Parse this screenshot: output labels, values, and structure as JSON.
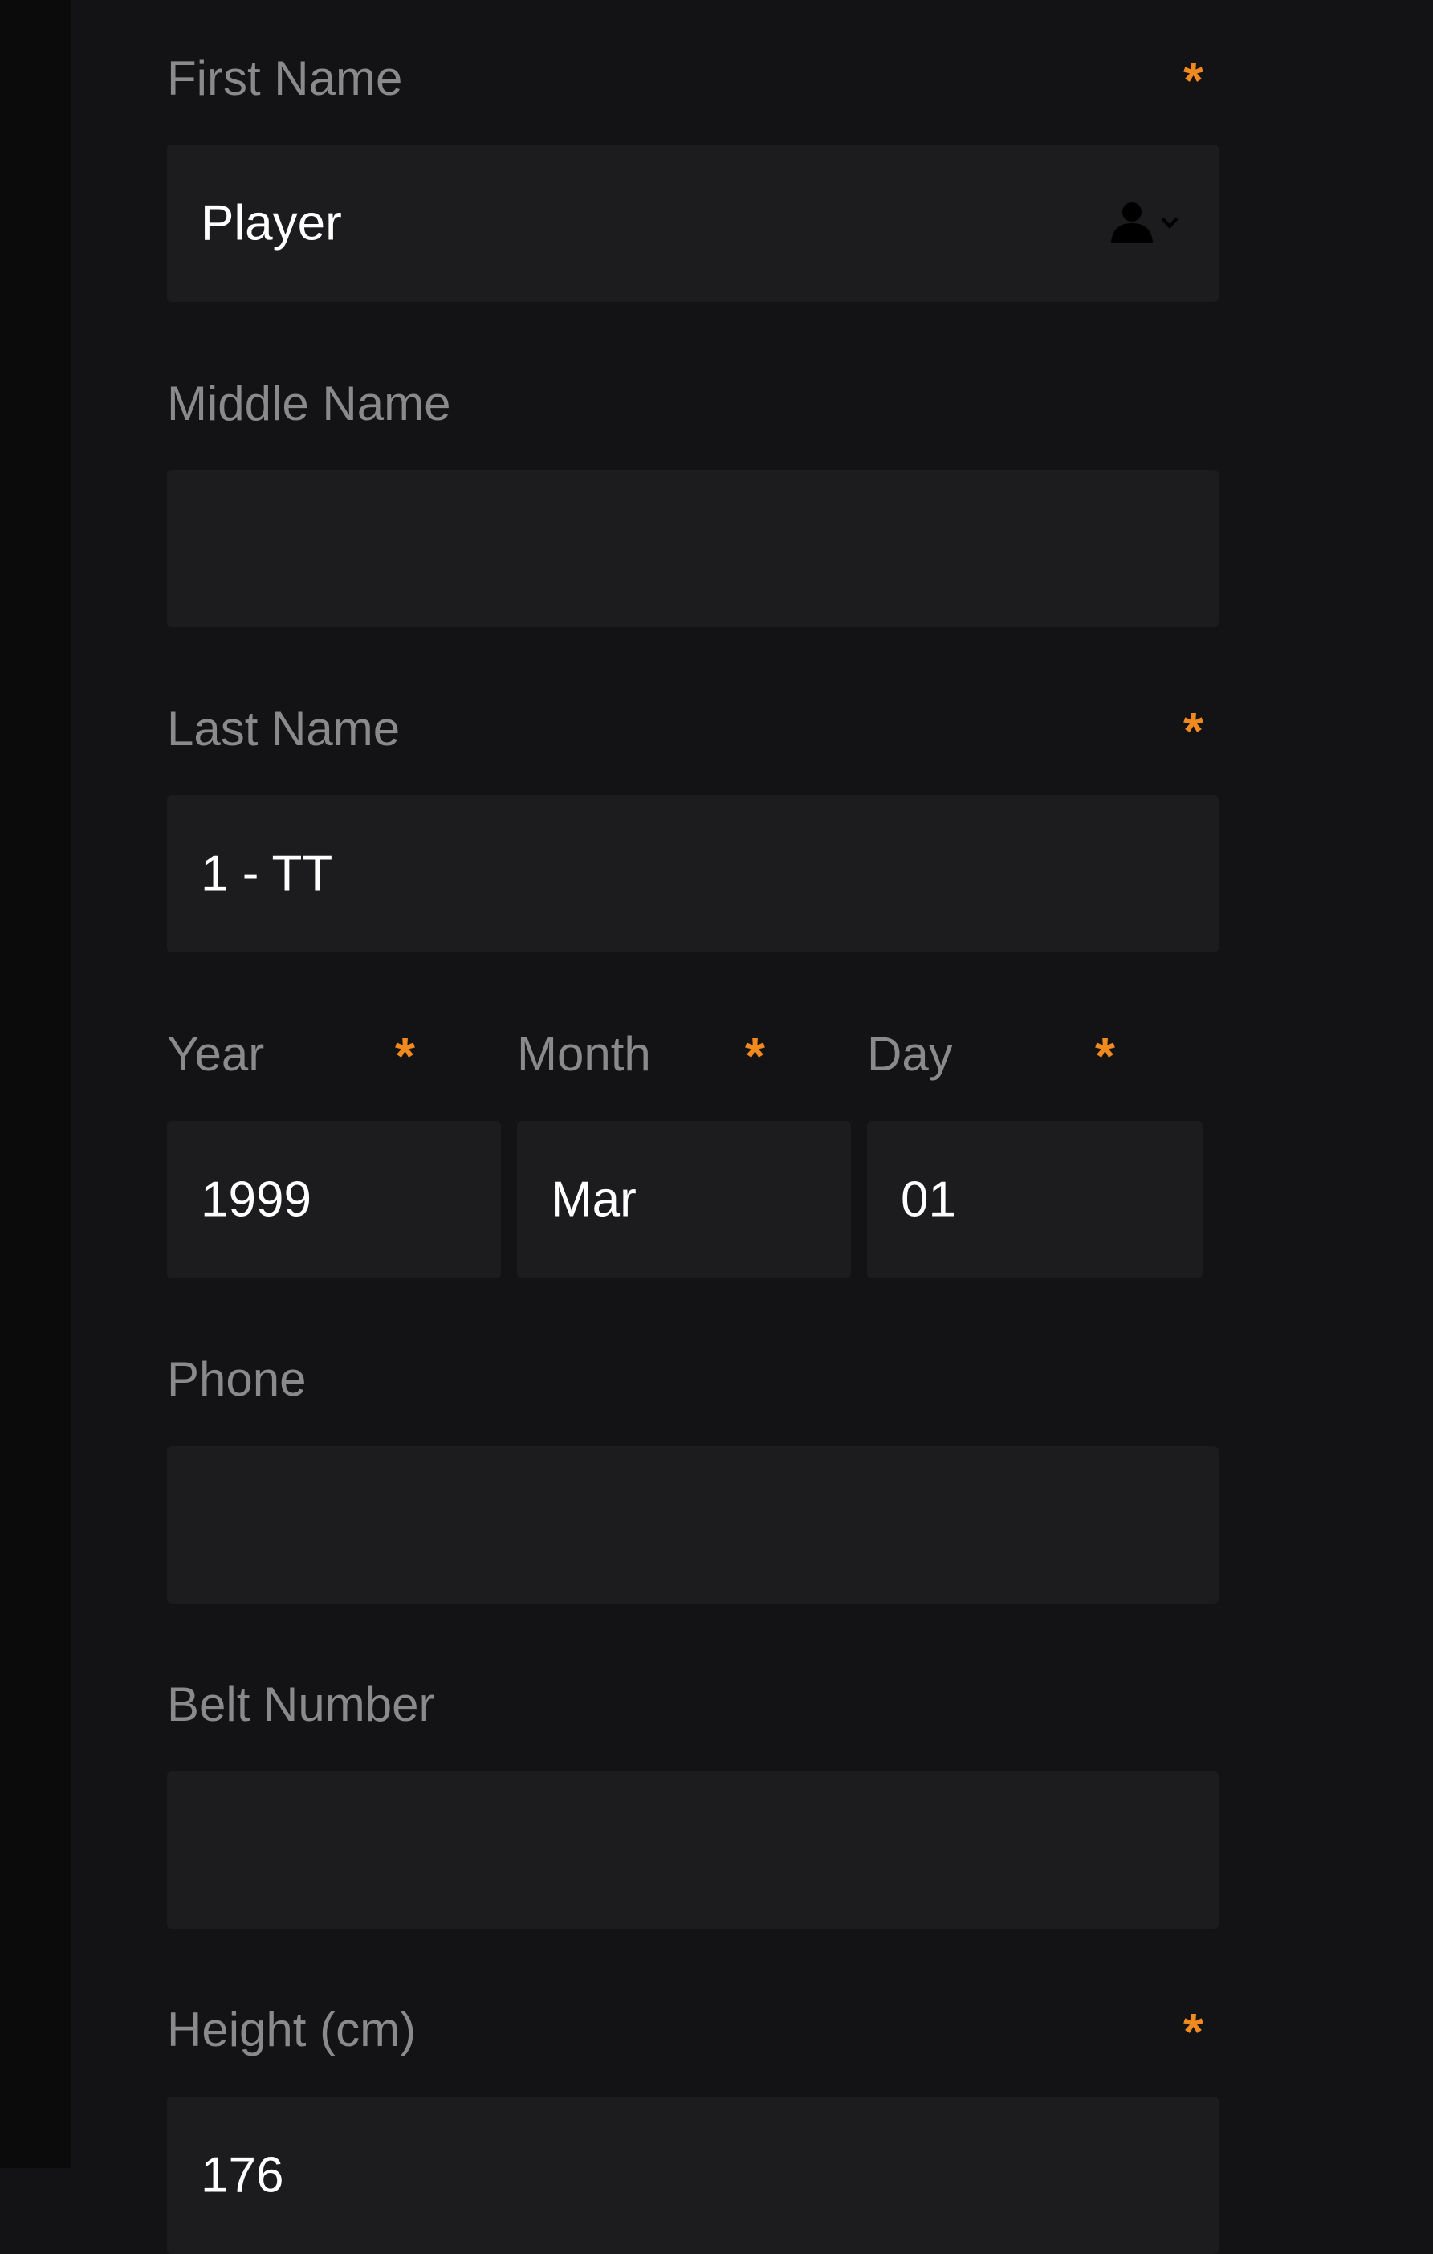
{
  "form": {
    "first_name": {
      "label": "First Name",
      "value": "Player"
    },
    "middle_name": {
      "label": "Middle Name",
      "value": ""
    },
    "last_name": {
      "label": "Last Name",
      "value": "1 - TT"
    },
    "dob": {
      "year": {
        "label": "Year",
        "value": "1999"
      },
      "month": {
        "label": "Month",
        "value": "Mar"
      },
      "day": {
        "label": "Day",
        "value": "01"
      }
    },
    "phone": {
      "label": "Phone",
      "value": ""
    },
    "belt_number": {
      "label": "Belt Number",
      "value": ""
    },
    "height": {
      "label": "Height (cm)",
      "value": "176"
    },
    "required_marker": "*"
  },
  "icons": {
    "contact_picker": "person-with-chevron-icon"
  },
  "colors": {
    "background": "#131315",
    "left_strip": "#0b0b0c",
    "field": "#1c1c1e",
    "label": "#8a8a8d",
    "value": "#ffffff",
    "required": "#f08a1e"
  }
}
